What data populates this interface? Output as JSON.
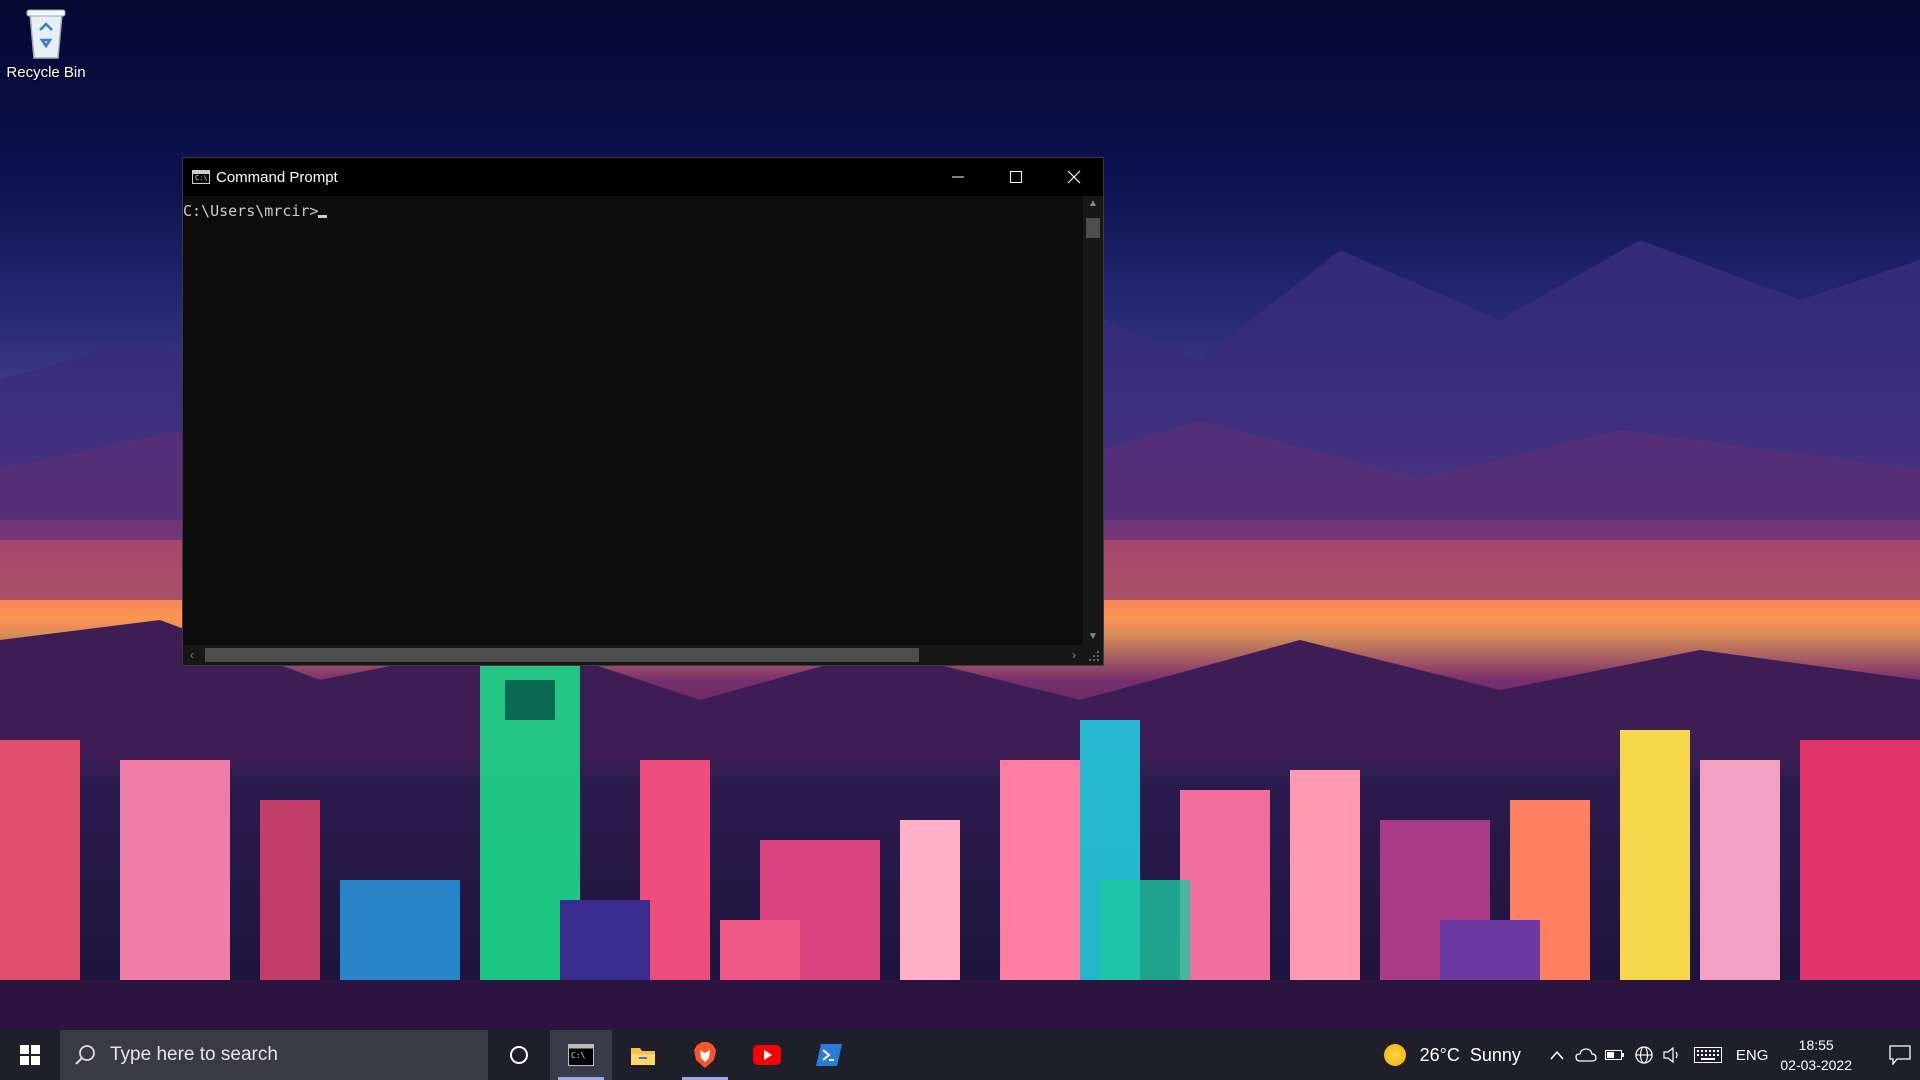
{
  "desktop": {
    "icons": [
      {
        "label": "Recycle Bin",
        "icon": "recycle-bin-icon"
      }
    ]
  },
  "cmd_window": {
    "title": "Command Prompt",
    "prompt": "C:\\Users\\mrcir>",
    "buttons": {
      "minimize": "minimize-icon",
      "maximize": "maximize-icon",
      "close": "close-icon"
    }
  },
  "taskbar": {
    "search_placeholder": "Type here to search",
    "apps": [
      {
        "name": "cortana",
        "icon": "cortana-icon"
      },
      {
        "name": "command-prompt",
        "icon": "cmd-icon",
        "active": true
      },
      {
        "name": "file-explorer",
        "icon": "folder-icon"
      },
      {
        "name": "brave",
        "icon": "brave-icon"
      },
      {
        "name": "youtube",
        "icon": "youtube-icon"
      },
      {
        "name": "powershell",
        "icon": "powershell-icon"
      }
    ],
    "tray": {
      "weather_temp": "26°C",
      "weather_desc": "Sunny",
      "language": "ENG",
      "time": "18:55",
      "date": "02-03-2022"
    }
  },
  "colors": {
    "taskbar_bg": "#1e1f2b",
    "console_bg": "#0c0c0c",
    "console_fg": "#cccccc",
    "youtube_red": "#ff0000",
    "brave_orange": "#fb542b",
    "powershell_blue": "#2a7dd6"
  }
}
